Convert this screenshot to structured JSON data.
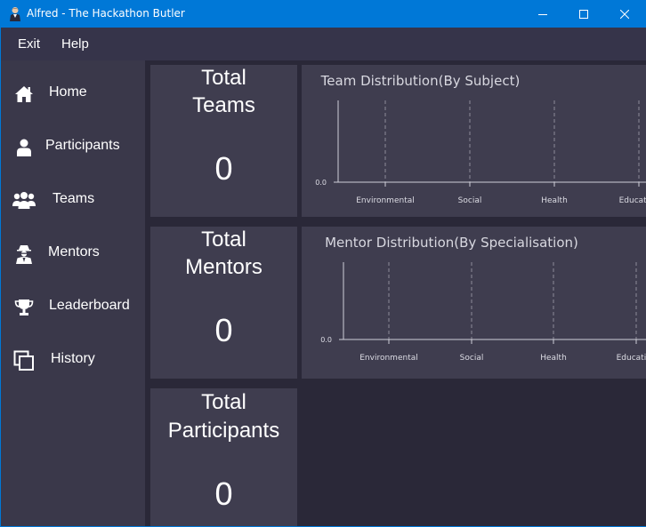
{
  "window": {
    "title": "Alfred - The Hackathon Butler",
    "accent_color": "#0078d7",
    "icon": "butler-avatar-icon"
  },
  "menu": {
    "items": [
      {
        "label": "Exit"
      },
      {
        "label": "Help"
      }
    ]
  },
  "sidebar": {
    "items": [
      {
        "label": "Home",
        "icon": "home-icon"
      },
      {
        "label": "Participants",
        "icon": "person-icon"
      },
      {
        "label": "Teams",
        "icon": "group-icon"
      },
      {
        "label": "Mentors",
        "icon": "mentor-icon"
      },
      {
        "label": "Leaderboard",
        "icon": "trophy-icon"
      },
      {
        "label": "History",
        "icon": "history-icon"
      }
    ]
  },
  "stats": {
    "teams": {
      "title_line1": "Total",
      "title_line2": "Teams",
      "value": "0"
    },
    "mentors": {
      "title_line1": "Total",
      "title_line2": "Mentors",
      "value": "0"
    },
    "participants": {
      "title_line1": "Total",
      "title_line2": "Participants",
      "value": "0"
    }
  },
  "chart_data": [
    {
      "type": "bar",
      "title": "Team Distribution(By Subject)",
      "categories": [
        "Environmental",
        "Social",
        "Health",
        "Education"
      ],
      "values": [
        0,
        0,
        0,
        0
      ],
      "y_ticks": [
        "0.0"
      ],
      "ylim": [
        0,
        0
      ],
      "grid": true,
      "legend": "none"
    },
    {
      "type": "bar",
      "title": "Mentor Distribution(By Specialisation)",
      "categories": [
        "Environmental",
        "Social",
        "Health",
        "Education"
      ],
      "values": [
        0,
        0,
        0,
        0
      ],
      "y_ticks": [
        "0.0"
      ],
      "ylim": [
        0,
        0
      ],
      "grid": true,
      "legend": "none"
    }
  ]
}
